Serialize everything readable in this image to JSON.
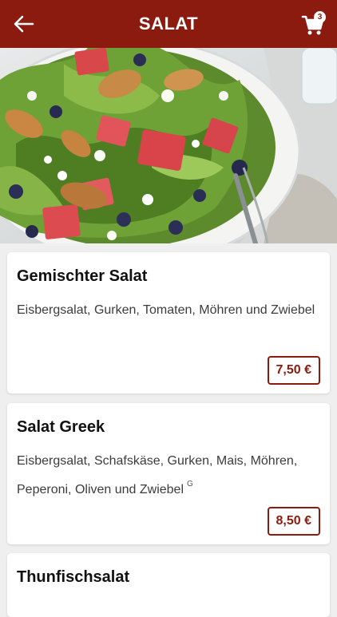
{
  "colors": {
    "brand": "#8b1a0f",
    "background": "#efefef",
    "card": "#ffffff"
  },
  "header": {
    "title": "SALAT",
    "back_icon": "arrow-left-icon",
    "cart_icon": "shopping-cart-icon",
    "cart_count": "3"
  },
  "hero": {
    "description": "bowl of mixed salad with shrimp, watermelon, feta and blueberries"
  },
  "products": [
    {
      "name": "Gemischter Salat",
      "description": "Eisbergsalat, Gurken, Tomaten, Möhren und Zwiebel",
      "note": "",
      "price": "7,50 €"
    },
    {
      "name": "Salat Greek",
      "description": "Eisbergsalat, Schafskäse, Gurken, Mais, Möhren, Peperoni, Oliven und Zwiebel",
      "note": "G",
      "price": "8,50 €"
    },
    {
      "name": "Thunfischsalat",
      "description": "",
      "note": "",
      "price": ""
    }
  ]
}
